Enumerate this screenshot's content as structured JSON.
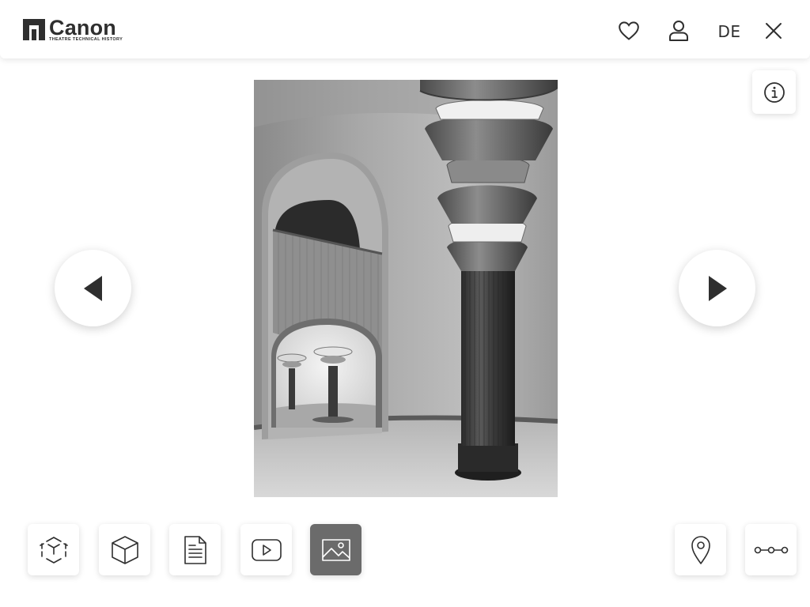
{
  "header": {
    "logo_name": "Canon",
    "logo_subtitle": "THEATRE TECHNICAL HISTORY",
    "favorite_icon": "heart-icon",
    "account_icon": "user-icon",
    "language": "DE",
    "close_icon": "close-icon"
  },
  "viewer": {
    "info_icon": "info-icon",
    "prev_icon": "triangle-left-icon",
    "next_icon": "triangle-right-icon",
    "image_description_icon": "photo-image"
  },
  "toolbar": {
    "left_tools": [
      {
        "name": "panorama-tool",
        "icon": "cube-expand-icon",
        "active": false
      },
      {
        "name": "3d-model-tool",
        "icon": "cube-icon",
        "active": false
      },
      {
        "name": "document-tool",
        "icon": "document-icon",
        "active": false
      },
      {
        "name": "video-tool",
        "icon": "play-icon",
        "active": false
      },
      {
        "name": "image-tool",
        "icon": "image-icon",
        "active": true
      }
    ],
    "right_tools": [
      {
        "name": "location-tool",
        "icon": "map-pin-icon",
        "active": false
      },
      {
        "name": "timeline-tool",
        "icon": "timeline-icon",
        "active": false
      }
    ]
  },
  "colors": {
    "icon": "#2f2f2f",
    "active_tool_bg": "#6b6b6b",
    "active_tool_icon": "#ffffff"
  }
}
